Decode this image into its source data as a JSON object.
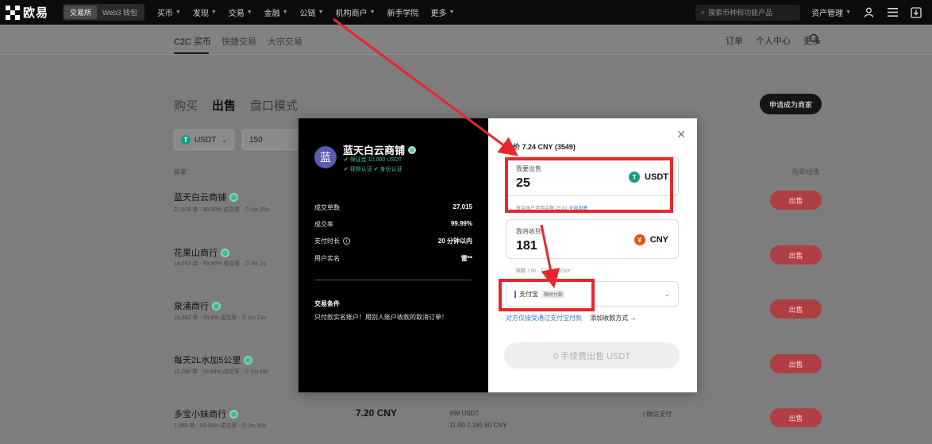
{
  "topnav": {
    "logo_text": "欧易",
    "mode_exchange": "交易所",
    "mode_web3": "Web3 钱包",
    "menu": [
      "买币",
      "发现",
      "交易",
      "金融",
      "公链",
      "机构商户",
      "新手学院",
      "更多"
    ],
    "search_placeholder": "搜索币种和功能产品",
    "assets": "资产管理"
  },
  "subnav": {
    "tabs": [
      "C2C 买币",
      "快捷交易",
      "大宗交易"
    ],
    "right": [
      "订单",
      "个人中心",
      "更多"
    ]
  },
  "main": {
    "mode_tabs": [
      "购买",
      "出售",
      "盘口模式"
    ],
    "apply_button": "申请成为商家",
    "filter_coin": "USDT",
    "filter_amount": "150",
    "col_merchant": "商家",
    "col_action": "购买/出售",
    "rows": [
      {
        "name": "蓝天白云商铺",
        "meta": "27,016 单 · 99.99% 成交率 · ⏱ 1m 25s",
        "action": "出售"
      },
      {
        "name": "花果山商行",
        "meta": "14,253 单 · 99.96% 成交率 · ⏱ 3m 1s",
        "action": "出售"
      },
      {
        "name": "泉涌商行",
        "meta": "24,882 单 · 99.9% 成交率 · ⏱ 1m 13s",
        "action": "出售"
      },
      {
        "name": "每天2L水加5公里",
        "meta": "11,288 单 · 99.94% 成交率 · ⏱ 1m 46s",
        "action": "出售"
      },
      {
        "name": "多宝小妹商行",
        "meta": "1,958 单 · 99.94% 成交率 · ⏱ 3m 50s",
        "action": "出售",
        "price": "7.20 CNY",
        "available": "998 USDT",
        "limit": "11.00-7,185.60 CNY",
        "payment": "| 微信支付"
      }
    ]
  },
  "modal": {
    "merchant": {
      "avatar_char": "蓝",
      "name": "蓝天白云商铺",
      "badge1": "✔ 保证金 10,000 USDT",
      "badge2": "✔ 视频认证  ✔ 身份认证"
    },
    "stats": [
      {
        "label": "成交单数",
        "value": "27,015"
      },
      {
        "label": "成交率",
        "value": "99.99%"
      },
      {
        "label": "支付时长",
        "value": "20 分钟以内"
      },
      {
        "label": "用户实名",
        "value": "雷**"
      }
    ],
    "terms_title": "交易条件",
    "terms_text": "只付款实名账户！用别人账户收款的取消订单！",
    "price_line": "单价 7.24 CNY (3549)",
    "sell_field": {
      "label": "我要出售",
      "value": "25",
      "currency": "USDT",
      "icon": "tether-icon"
    },
    "sell_hint": "资金账户可用余额 25.82",
    "sell_hint_link": "全部出售",
    "receive_field": {
      "label": "我将收到",
      "value": "181",
      "currency": "CNY",
      "icon": "yuan-icon"
    },
    "receive_hint": "限额 7.00 - 7,185.87 CNY",
    "payment_method": "支付宝",
    "payment_tag": "限时付款",
    "payment_note": "对方仅接受通过支付宝付款",
    "add_method": "添加收款方式 →",
    "submit": "0 手续费出售 USDT"
  },
  "colors": {
    "annotation": "#e8262c",
    "sell_button": "#b03e45",
    "usdt": "#1a9b84",
    "cny": "#e5531d"
  }
}
